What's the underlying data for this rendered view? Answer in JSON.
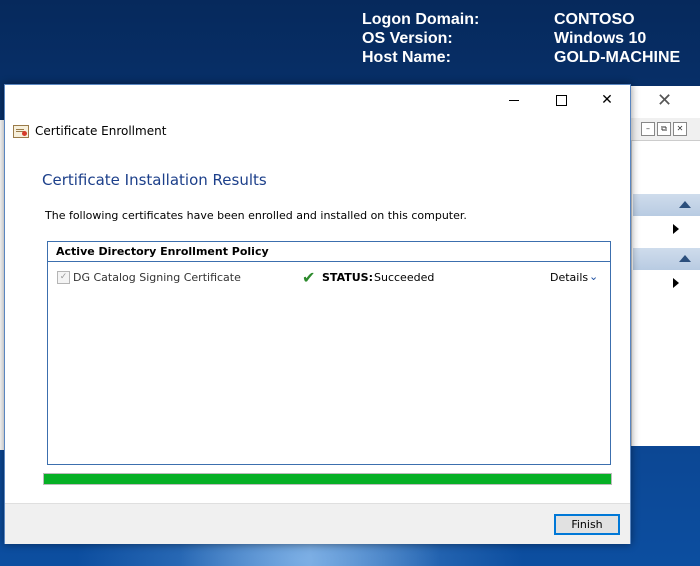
{
  "bginfo": {
    "rows": [
      {
        "key": "Logon Domain:",
        "value": "CONTOSO"
      },
      {
        "key": "OS Version:",
        "value": "Windows 10"
      },
      {
        "key": "Host Name:",
        "value": "GOLD-MACHINE"
      }
    ]
  },
  "background_window": {
    "close_glyph": "✕",
    "restore_glyph": "⧉",
    "close2_glyph": "✕",
    "min_glyph": "–"
  },
  "dialog": {
    "title": "Certificate Enrollment",
    "window_buttons": {
      "close_glyph": "✕"
    },
    "heading": "Certificate Installation Results",
    "description": "The following certificates have been enrolled and installed on this computer.",
    "policy_header": "Active Directory Enrollment Policy",
    "certificate": {
      "name": "DG Catalog Signing Certificate",
      "checked": true,
      "checkbox_glyph": "✓",
      "status_check_glyph": "✔",
      "status_label": "STATUS:",
      "status_value": "Succeeded",
      "details_label": "Details",
      "details_chevron": "⌄"
    },
    "progress_percent": 100,
    "finish_label": "Finish"
  },
  "colors": {
    "heading": "#1c3f8a",
    "progress_fill": "#06b025",
    "panel_border": "#3c6fae",
    "desktop": "#0b3f86"
  }
}
